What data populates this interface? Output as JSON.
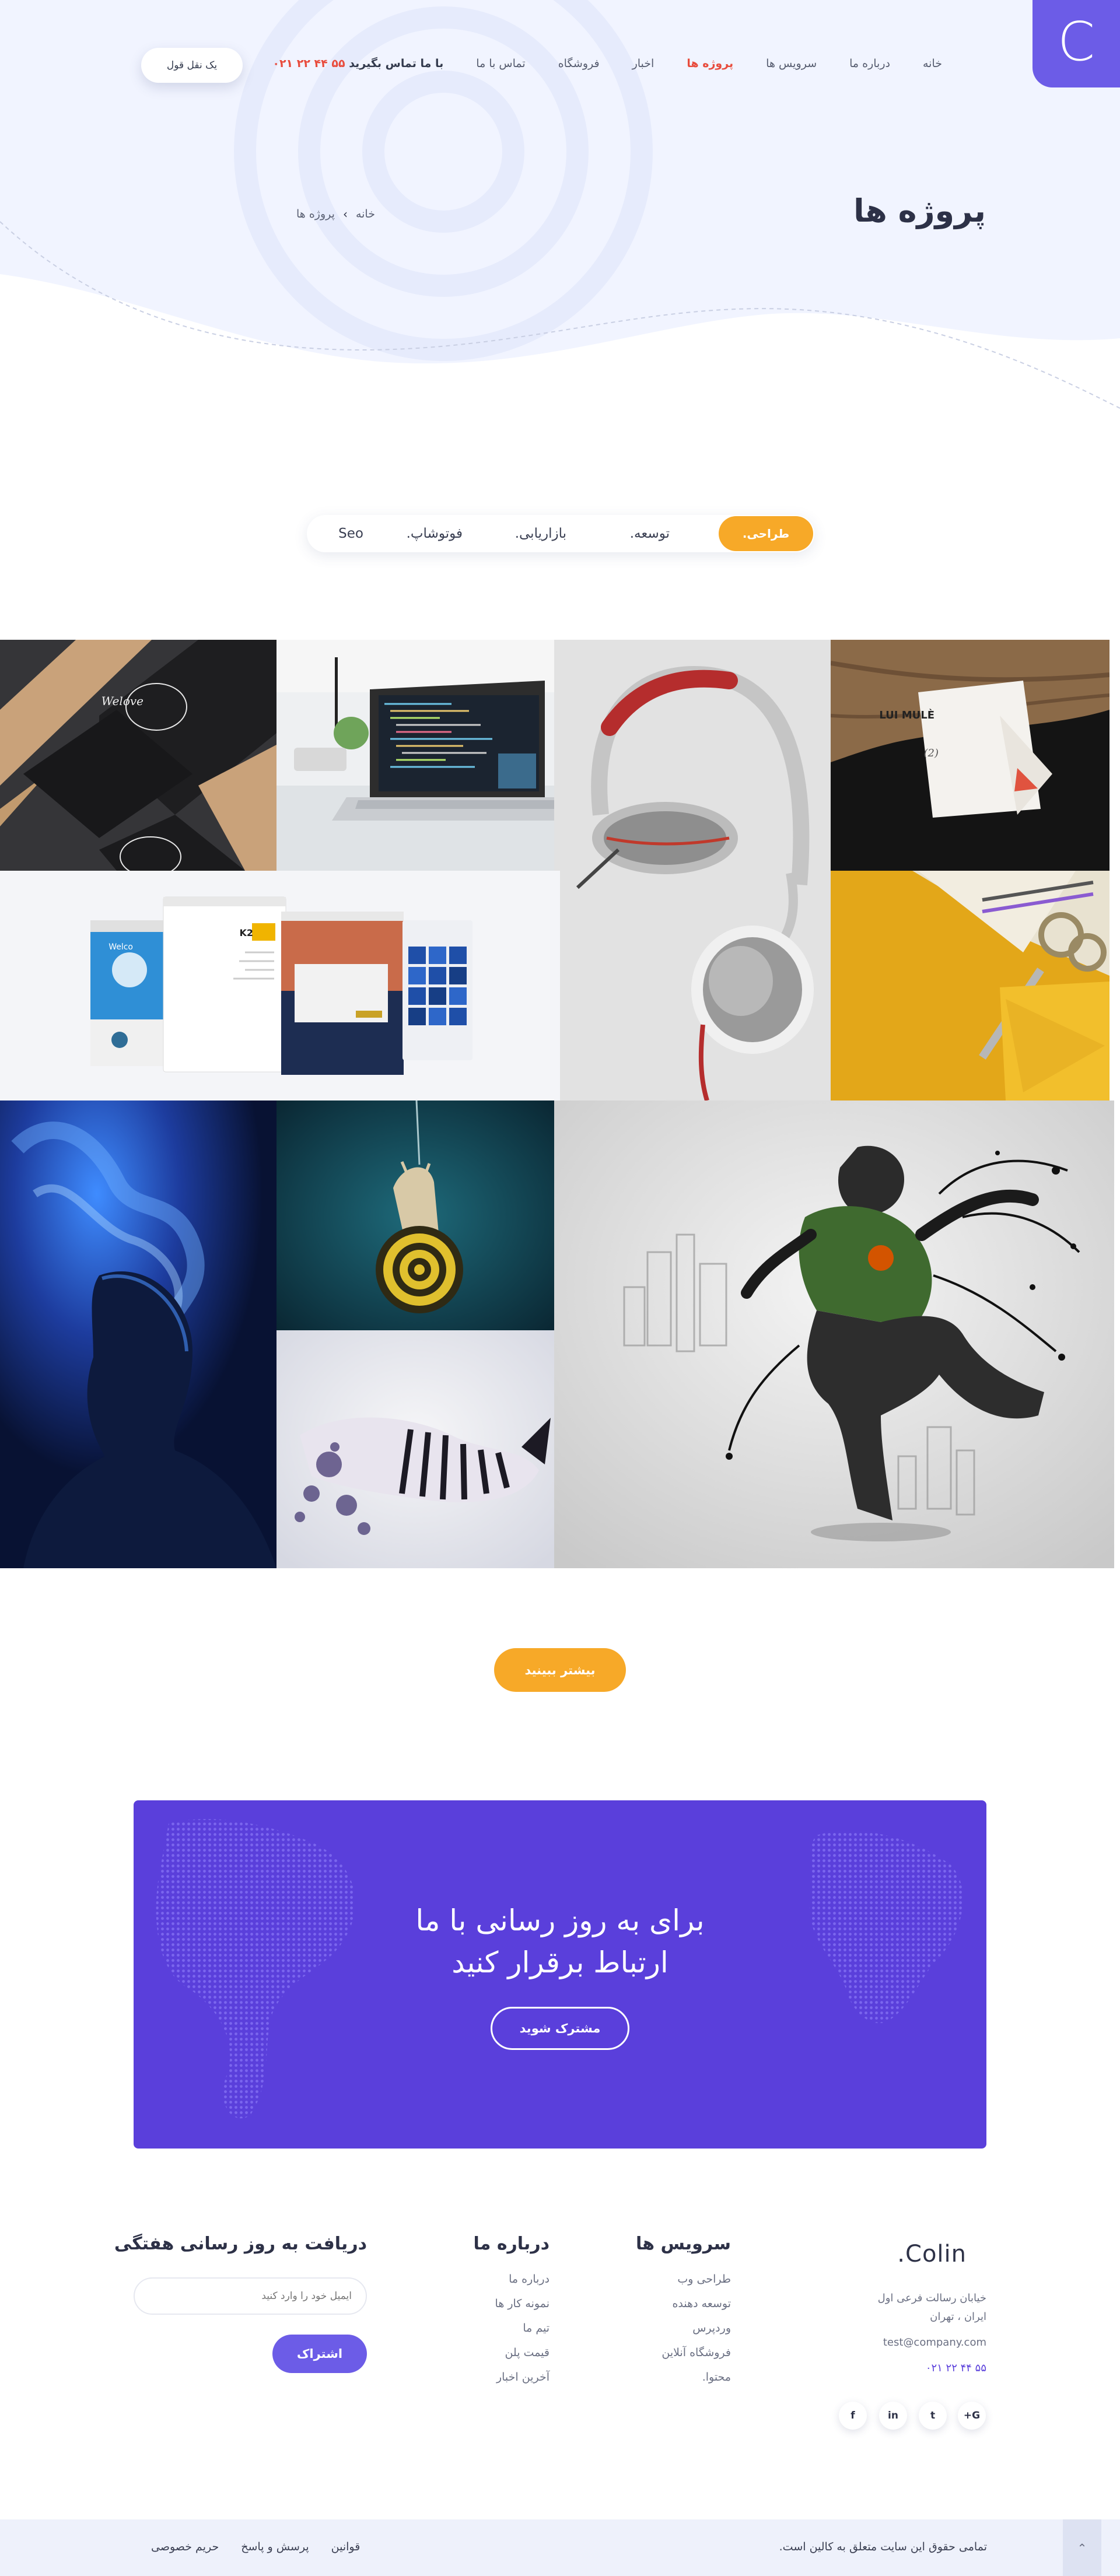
{
  "brand": {
    "logo_letter": "C",
    "name": "Colin.",
    "accent": "#6c5ce7",
    "orange": "#f7a928",
    "purple": "#5a3fdb"
  },
  "nav": {
    "items": [
      "خانه",
      "درباره ما",
      "سرویس ها",
      "پروژه ها",
      "اخبار",
      "فروشگاه",
      "تماس با ما"
    ],
    "active_index": 3,
    "contact_prefix": "با ما تماس بگیرید",
    "contact_phone": "۰۲۱ ۲۲ ۴۴ ۵۵",
    "cta": "یک نقل قول"
  },
  "header": {
    "title": "پروژه ها",
    "breadcrumb": [
      "خانه",
      "پروژه ها"
    ],
    "breadcrumb_sep": "›"
  },
  "filter": {
    "items": [
      "طراحی.",
      "توسعه.",
      "بازاریابی.",
      "فوتوشاپ.",
      "Seo"
    ],
    "active_index": 0
  },
  "gallery": {
    "tiles": [
      {
        "name": "business-card-tile",
        "logo_text": "Welove"
      },
      {
        "name": "laptop-code-tile"
      },
      {
        "name": "headphones-tile"
      },
      {
        "name": "tag-mockup-tile",
        "tag_brand": "LUI MULÈ",
        "tag_sub": "(2)"
      },
      {
        "name": "web-mockup-tile",
        "screen_a": "Welco",
        "screen_b": "K2"
      },
      {
        "name": "stationery-tile"
      },
      {
        "name": "smoke-portrait-tile"
      },
      {
        "name": "snail-tile"
      },
      {
        "name": "zebra-splash-tile"
      },
      {
        "name": "dancer-tile"
      }
    ]
  },
  "more_button": "بیشتر ببینید",
  "newsletter": {
    "line1": "برای به روز رسانی با ما",
    "line2": "ارتباط برقرار کنید",
    "button": "مشترک شوید"
  },
  "footer": {
    "address_line1": "خیابان رسالت فرعی اول",
    "address_line2": "ایران ، تهران",
    "email": "test@company.com",
    "phone": "۰۲۱ ۲۲ ۴۴ ۵۵",
    "social": [
      "f",
      "in",
      "t",
      "G+"
    ],
    "services_title": "سرویس ها",
    "services": [
      "طراحی وب",
      "توسعه دهنده",
      "وردپرس",
      "فروشگاه آنلاین",
      "محتوا."
    ],
    "about_title": "درباره ما",
    "about": [
      "درباره ما",
      "نمونه کار ها",
      "تیم ما",
      "قیمت پلن",
      "آخرین اخبار"
    ],
    "newsletter_title": "دریافت به روز رسانی هفتگی",
    "email_placeholder": "ایمیل خود را وارد کنید",
    "join_button": "اشتراک",
    "copyright": "تمامی حقوق این سایت متعلق به کالین است.",
    "bottom_links": [
      "قوانین",
      "پرسش و پاسخ",
      "حریم خصوصی"
    ],
    "top_arrow": "⌃"
  }
}
